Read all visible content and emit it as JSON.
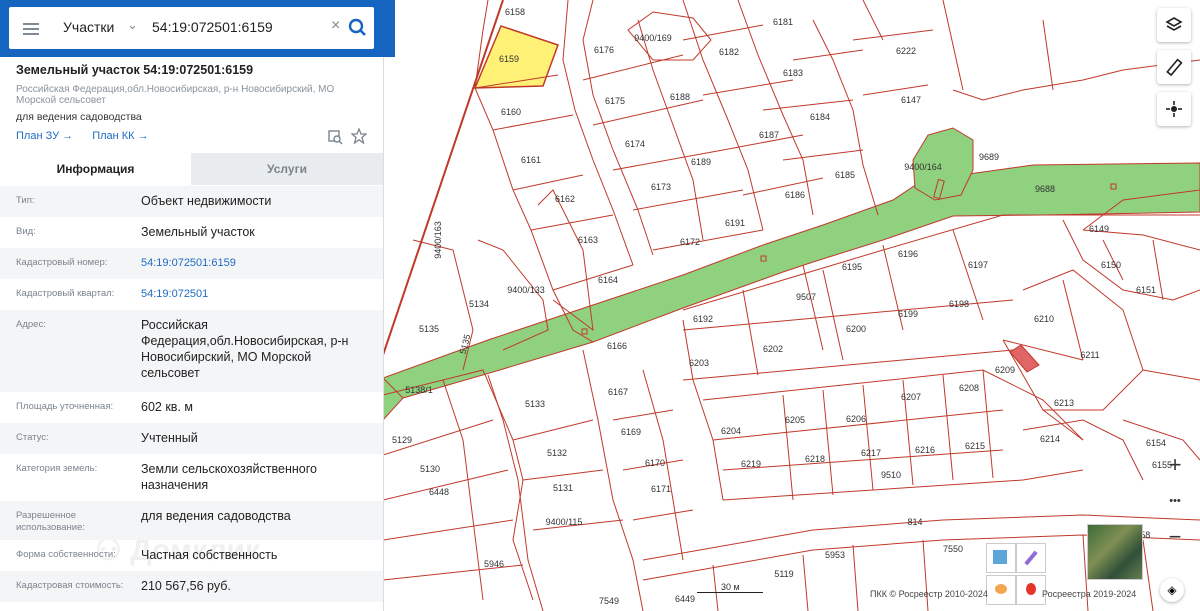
{
  "search": {
    "type_label": "Участки",
    "query": "54:19:072501:6159"
  },
  "card": {
    "title": "Земельный участок 54:19:072501:6159",
    "address_short": "Российская Федерация,обл.Новосибирская, р-н Новосибирский, МО Морской сельсовет",
    "purpose": "для ведения садоводства",
    "link_zu": "План ЗУ →",
    "link_kk": "План КК →"
  },
  "tabs": {
    "info": "Информация",
    "services": "Услуги"
  },
  "fields": [
    {
      "label": "Тип:",
      "value": "Объект недвижимости"
    },
    {
      "label": "Вид:",
      "value": "Земельный участок"
    },
    {
      "label": "Кадастровый номер:",
      "value": "54:19:072501:6159"
    },
    {
      "label": "Кадастровый квартал:",
      "value": "54:19:072501"
    },
    {
      "label": "Адрес:",
      "value": "Российская Федерация,обл.Новосибирская, р-н Новосибирский, МО Морской сельсовет"
    },
    {
      "label": "Площадь уточненная:",
      "value": "602 кв. м"
    },
    {
      "label": "Статус:",
      "value": "Учтенный"
    },
    {
      "label": "Категория земель:",
      "value": "Земли сельскохозяйственного назначения"
    },
    {
      "label": "Разрешенное использование:",
      "value": "для ведения садоводства"
    },
    {
      "label": "Форма собственности:",
      "value": "Частная собственность"
    },
    {
      "label": "Кадастровая стоимость:",
      "value": "210 567,56 руб."
    }
  ],
  "map": {
    "scale_label": "30 м",
    "attribution_pkk": "ПКК © Росреестр 2010-2024",
    "attribution_rr": "Росреестра 2019-2024",
    "selected_parcel": "6159",
    "parcel_labels": [
      "6158",
      "6159",
      "6160",
      "6161",
      "6162",
      "6163",
      "6164",
      "6166",
      "6167",
      "6169",
      "6170",
      "6171",
      "6176",
      "9400/169",
      "6181",
      "6182",
      "6183",
      "6175",
      "6188",
      "6174",
      "6173",
      "6172",
      "6189",
      "6187",
      "6184",
      "6186",
      "6185",
      "6191",
      "6222",
      "6147",
      "9400/164",
      "9689",
      "9688",
      "6149",
      "6150",
      "6151",
      "6195",
      "6196",
      "6197",
      "6198",
      "6199",
      "6200",
      "6192",
      "6203",
      "6202",
      "9507",
      "6210",
      "6211",
      "6209",
      "6208",
      "6207",
      "6206",
      "6205",
      "6204",
      "6213",
      "6214",
      "6215",
      "6216",
      "6217",
      "6218",
      "6219",
      "6154",
      "6155",
      "9510",
      "814",
      "5135",
      "5134",
      "9400/133",
      "9400/163",
      "5135",
      "5138/1",
      "5133",
      "5129",
      "5130",
      "5132",
      "5131",
      "9400/115",
      "6448",
      "5946",
      "5953",
      "5119",
      "6449",
      "7549",
      "7550",
      "6.258"
    ],
    "colors": {
      "parcel_line": "#c0392b",
      "road": "#8fd17e",
      "selected": "#fff176",
      "red_parcel": "#e06666"
    }
  },
  "controls": {
    "zoom_in": "+",
    "zoom_out": "−",
    "more": "•••"
  }
}
